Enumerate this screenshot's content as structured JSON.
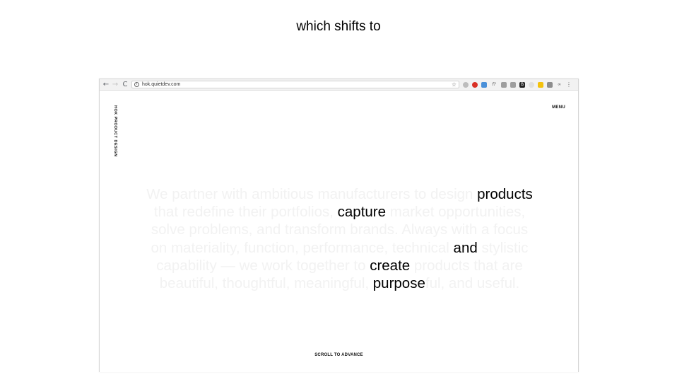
{
  "slide": {
    "caption": "which shifts to"
  },
  "browser": {
    "url": "hok.quietdev.com",
    "nav": {
      "back": "←",
      "forward": "→",
      "reload": "C"
    },
    "info_icon": "i",
    "star_icon": "☆",
    "extensions": [
      "ext-grey-circle",
      "ext-red-circle",
      "ext-blue",
      "ext-f",
      "ext-cast",
      "ext-grey",
      "ext-b",
      "ext-light",
      "ext-yellow",
      "ext-square",
      "ext-link",
      "ext-menu"
    ]
  },
  "site": {
    "brand": "HOK PRODUCT DESIGN",
    "menu": "MENU",
    "hero_lines": [
      {
        "pre": "We partner with ambitious manufacturers to design ",
        "hl": "products",
        "post": ""
      },
      {
        "pre": "that redefine their portfolios, ",
        "hl": "capture",
        "post": " market opportunities,"
      },
      {
        "pre": "solve problems, and transform brands. Always with a focus",
        "hl": "",
        "post": ""
      },
      {
        "pre": "on materiality, function, performance, technical ",
        "hl": "and",
        "post": " stylistic"
      },
      {
        "pre": "capability — we work together to ",
        "hl": "create",
        "post": " products that are"
      },
      {
        "pre": "beautiful, thoughtful, meaningful, ",
        "hl": "purpose",
        "post": "ful, and useful."
      }
    ],
    "scroll_hint": "SCROLL TO ADVANCE"
  }
}
